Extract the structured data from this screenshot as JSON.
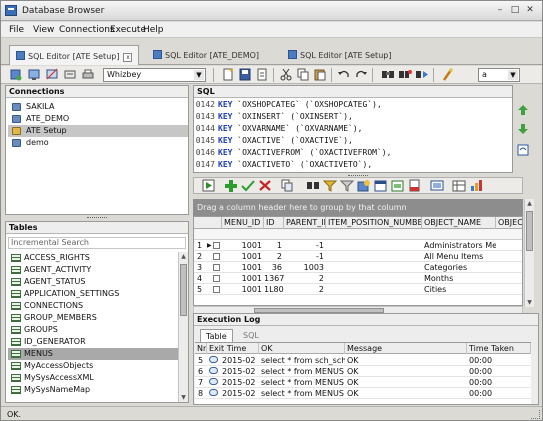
{
  "window": {
    "title": "Database Browser"
  },
  "menubar": [
    "File",
    "View",
    "Connections",
    "Execute",
    "Help"
  ],
  "editor_tabs": [
    {
      "label": "SQL Editor [ATE Setup]",
      "active": true
    },
    {
      "label": "SQL Editor [ATE_DEMO]",
      "active": false
    },
    {
      "label": "SQL Editor [ATE Setup]",
      "active": false
    }
  ],
  "toolbar": {
    "datasource_value": "Whizbey",
    "font_value": "a"
  },
  "connections": {
    "header": "Connections",
    "items": [
      {
        "label": "SAKILA",
        "selected": false
      },
      {
        "label": "ATE_DEMO",
        "selected": false
      },
      {
        "label": "ATE Setup",
        "selected": true
      },
      {
        "label": "demo",
        "selected": false
      }
    ]
  },
  "tables": {
    "header": "Tables",
    "search_placeholder": "Incremental Search",
    "items": [
      {
        "label": "ACCESS_RIGHTS",
        "selected": false
      },
      {
        "label": "AGENT_ACTIVITY",
        "selected": false
      },
      {
        "label": "AGENT_STATUS",
        "selected": false
      },
      {
        "label": "APPLICATION_SETTINGS",
        "selected": false
      },
      {
        "label": "CONNECTIONS",
        "selected": false
      },
      {
        "label": "GROUP_MEMBERS",
        "selected": false
      },
      {
        "label": "GROUPS",
        "selected": false
      },
      {
        "label": "ID_GENERATOR",
        "selected": false
      },
      {
        "label": "MENUS",
        "selected": true
      },
      {
        "label": "MyAccessObjects",
        "selected": false
      },
      {
        "label": "MySysAccessXML",
        "selected": false
      },
      {
        "label": "MySysNameMap",
        "selected": false
      }
    ]
  },
  "sql": {
    "header": "SQL",
    "lines": [
      {
        "num": "0142",
        "kw": "KEY",
        "text": " `OXSHOPCATEG` (`OXSHOPCATEG`),"
      },
      {
        "num": "0143",
        "kw": "KEY",
        "text": " `OXINSERT` (`OXINSERT`),"
      },
      {
        "num": "0144",
        "kw": "KEY",
        "text": " `OXVARNAME` (`OXVARNAME`),"
      },
      {
        "num": "0145",
        "kw": "KEY",
        "text": " `OXACTIVE` (`OXACTIVE`),"
      },
      {
        "num": "0146",
        "kw": "KEY",
        "text": " `OXACTIVEFROM` (`OXACTIVEFROM`),"
      },
      {
        "num": "0147",
        "kw": "KEY",
        "text": " `OXACTIVETO` (`OXACTIVETO`),"
      }
    ]
  },
  "result_grid": {
    "group_hint": "Drag a column header here to group by that column",
    "columns": [
      "MENU_ID",
      "ID",
      "PARENT_ID",
      "ITEM_POSITION_NUMBER",
      "OBJECT_NAME",
      "OBJECT"
    ],
    "rows": [
      {
        "num": "1",
        "c1": "1001",
        "c2": "1",
        "c3": "-1",
        "c4": "",
        "c5": "Administrators Menu"
      },
      {
        "num": "2",
        "c1": "1001",
        "c2": "2",
        "c3": "-1",
        "c4": "",
        "c5": "All Menu Items"
      },
      {
        "num": "3",
        "c1": "1001",
        "c2": "36",
        "c3": "1003",
        "c4": "",
        "c5": "Categories"
      },
      {
        "num": "4",
        "c1": "1001",
        "c2": "1367",
        "c3": "2",
        "c4": "",
        "c5": "Months"
      },
      {
        "num": "5",
        "c1": "1001",
        "c2": "1L80",
        "c3": "2",
        "c4": "",
        "c5": "Cities"
      }
    ]
  },
  "execution_log": {
    "header": "Execution Log",
    "tabs": [
      "Table",
      "SQL"
    ],
    "columns": [
      "Nr",
      "Exit Time",
      "OK",
      "Message",
      "Time Taken"
    ],
    "rows": [
      {
        "nr": "5",
        "time": "2015-02",
        "sql": "select * from sch_schedule",
        "msg": "OK",
        "taken": "00:00"
      },
      {
        "nr": "6",
        "time": "2015-02",
        "sql": "select * from MENUS",
        "msg": "OK",
        "taken": "00:00"
      },
      {
        "nr": "7",
        "time": "2015-02",
        "sql": "select * from MENUS",
        "msg": "OK",
        "taken": "00:00"
      },
      {
        "nr": "8",
        "time": "2015-02",
        "sql": "select * from MENUS",
        "msg": "OK",
        "taken": "00:00"
      }
    ]
  },
  "status": {
    "text": "OK."
  }
}
